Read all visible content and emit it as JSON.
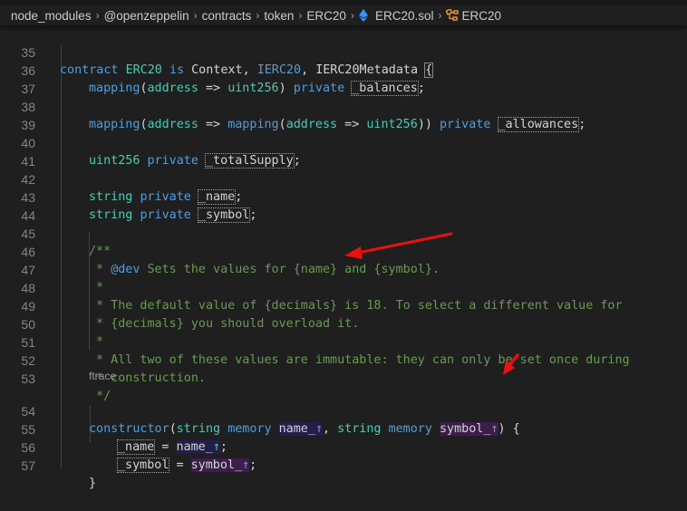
{
  "breadcrumb": {
    "items": [
      "node_modules",
      "@openzeppelin",
      "contracts",
      "token",
      "ERC20",
      "ERC20.sol",
      "ERC20"
    ],
    "separator": "›",
    "file_icon": "ethereum-icon",
    "symbol_icon": "struct-icon"
  },
  "codelens": {
    "ftrace": "ftrace"
  },
  "lines": [
    {
      "n": "35"
    },
    {
      "n": "36"
    },
    {
      "n": "37"
    },
    {
      "n": "38"
    },
    {
      "n": "39"
    },
    {
      "n": "40"
    },
    {
      "n": "41"
    },
    {
      "n": "42"
    },
    {
      "n": "43"
    },
    {
      "n": "44"
    },
    {
      "n": "45"
    },
    {
      "n": "46"
    },
    {
      "n": "47"
    },
    {
      "n": "48"
    },
    {
      "n": "49"
    },
    {
      "n": "50"
    },
    {
      "n": "51"
    },
    {
      "n": "52"
    },
    {
      "n": "53"
    },
    {
      "n": "54"
    },
    {
      "n": "55"
    },
    {
      "n": "56"
    },
    {
      "n": "57"
    }
  ],
  "code": {
    "l35": {
      "contract": "contract",
      "name": "ERC20",
      "is": "is",
      "context": "Context",
      "comma1": ",",
      "ierc20": "IERC20",
      "comma2": ",",
      "meta": "IERC20Metadata",
      "brace": "{"
    },
    "l36": {
      "mapping": "mapping",
      "p1": "(",
      "address": "address",
      "arrow": " => ",
      "uint": "uint256",
      "p2": ")",
      "private": "private",
      "var": "_balances",
      "semi": ";"
    },
    "l38": {
      "mapping": "mapping",
      "p1": "(",
      "address": "address",
      "arrow": " => ",
      "mapping2": "mapping",
      "p2": "(",
      "address2": "address",
      "arrow2": " => ",
      "uint": "uint256",
      "p3": "))",
      "private": "private",
      "var": "_allowances",
      "semi": ";"
    },
    "l40": {
      "uint": "uint256",
      "private": "private",
      "var": "_totalSupply",
      "semi": ";"
    },
    "l42": {
      "string": "string",
      "private": "private",
      "var": "_name",
      "semi": ";"
    },
    "l43": {
      "string": "string",
      "private": "private",
      "var": "_symbol",
      "semi": ";"
    },
    "l45": "/**",
    "l46": {
      "star": " * ",
      "tag": "@dev",
      "text": " Sets the values for {name} and {symbol}."
    },
    "l47": " *",
    "l48": " * The default value of {decimals} is 18. To select a different value for",
    "l49": " * {decimals} you should overload it.",
    "l50": " *",
    "l51": " * All two of these values are immutable: they can only be set once during",
    "l52": " * construction.",
    "l53": " */",
    "l54": {
      "constructor": "constructor",
      "p1": "(",
      "string": "string",
      "memory": "memory",
      "param1": "name_",
      "up1": "↑",
      "comma": ", ",
      "string2": "string",
      "memory2": "memory",
      "param2": "symbol_",
      "up2": "↑",
      "close": ") {"
    },
    "l55": {
      "var": "_name",
      "eq": " = ",
      "param": "name_",
      "up": "↑",
      "semi": ";"
    },
    "l56": {
      "var": "_symbol",
      "eq": " = ",
      "param": "symbol_",
      "up": "↑",
      "semi": ";"
    },
    "l57": "}"
  },
  "annotations": [
    {
      "type": "red-arrow",
      "points_to": "comment line 47 / @dev documentation"
    },
    {
      "type": "red-arrow",
      "points_to": "symbol_ parameter"
    }
  ],
  "colors": {
    "background": "#1f1f1f",
    "keyword": "#569cd6",
    "type": "#4ec9b0",
    "comment": "#6a9955",
    "annotation_arrow": "#e81010"
  }
}
